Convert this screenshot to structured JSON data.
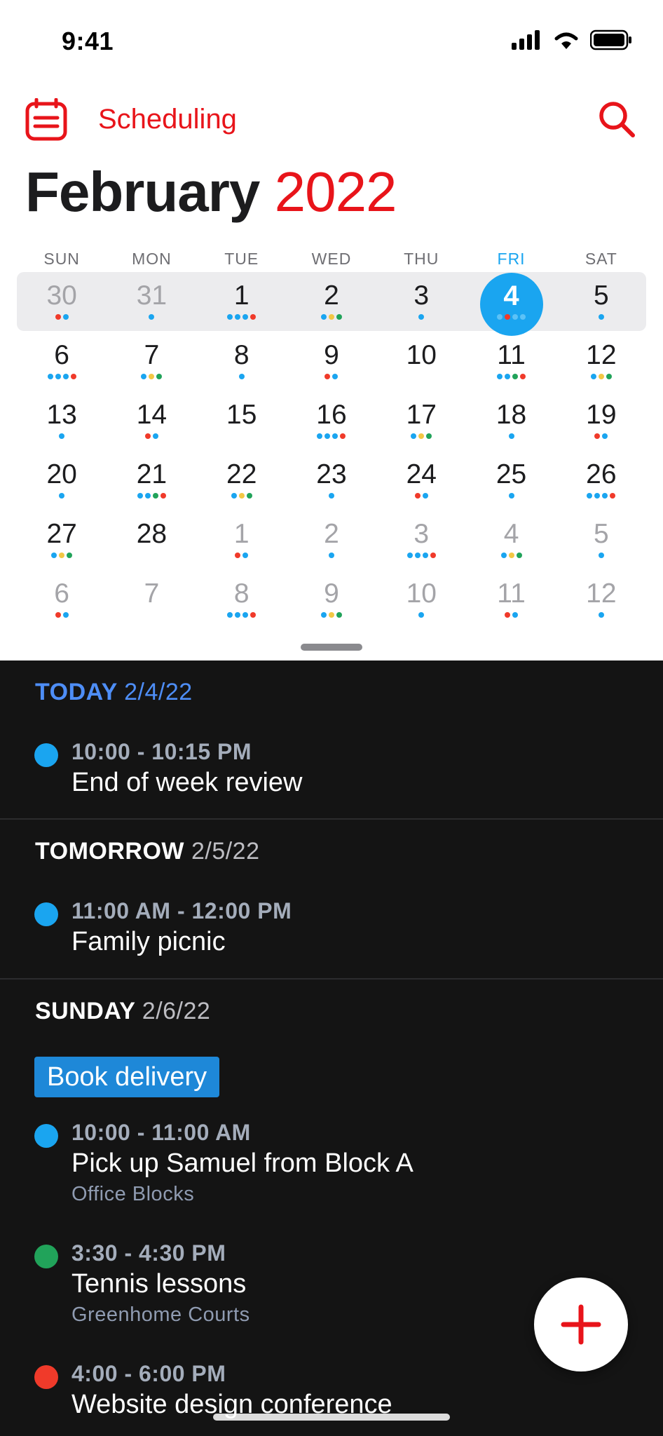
{
  "status": {
    "time": "9:41"
  },
  "header": {
    "app_title": "Scheduling"
  },
  "month": {
    "name": "February",
    "year": "2022"
  },
  "colors": {
    "blue": "#1aa5f0",
    "red": "#f03a2a",
    "green": "#21a35a",
    "yellow": "#f2c744",
    "accent": "#e8141a"
  },
  "weekdays": [
    "SUN",
    "MON",
    "TUE",
    "WED",
    "THU",
    "FRI",
    "SAT"
  ],
  "weeks": [
    [
      {
        "n": "30",
        "m": true,
        "d": [
          "red",
          "blue"
        ]
      },
      {
        "n": "31",
        "m": true,
        "d": [
          "blue"
        ]
      },
      {
        "n": "1",
        "d": [
          "blue",
          "blue",
          "blue",
          "red"
        ]
      },
      {
        "n": "2",
        "d": [
          "blue",
          "yellow",
          "green"
        ]
      },
      {
        "n": "3",
        "d": [
          "blue"
        ]
      },
      {
        "n": "4",
        "t": true,
        "d": [
          "blue",
          "red",
          "blue",
          "blue"
        ]
      },
      {
        "n": "5",
        "d": [
          "blue"
        ]
      }
    ],
    [
      {
        "n": "6",
        "d": [
          "blue",
          "blue",
          "blue",
          "red"
        ]
      },
      {
        "n": "7",
        "d": [
          "blue",
          "yellow",
          "green"
        ]
      },
      {
        "n": "8",
        "d": [
          "blue"
        ]
      },
      {
        "n": "9",
        "d": [
          "red",
          "blue"
        ]
      },
      {
        "n": "10",
        "d": []
      },
      {
        "n": "11",
        "d": [
          "blue",
          "blue",
          "green",
          "red"
        ]
      },
      {
        "n": "12",
        "d": [
          "blue",
          "yellow",
          "green"
        ]
      }
    ],
    [
      {
        "n": "13",
        "d": [
          "blue"
        ]
      },
      {
        "n": "14",
        "d": [
          "red",
          "blue"
        ]
      },
      {
        "n": "15",
        "d": []
      },
      {
        "n": "16",
        "d": [
          "blue",
          "blue",
          "blue",
          "red"
        ]
      },
      {
        "n": "17",
        "d": [
          "blue",
          "yellow",
          "green"
        ]
      },
      {
        "n": "18",
        "d": [
          "blue"
        ]
      },
      {
        "n": "19",
        "d": [
          "red",
          "blue"
        ]
      }
    ],
    [
      {
        "n": "20",
        "d": [
          "blue"
        ]
      },
      {
        "n": "21",
        "d": [
          "blue",
          "blue",
          "green",
          "red"
        ]
      },
      {
        "n": "22",
        "d": [
          "blue",
          "yellow",
          "green"
        ]
      },
      {
        "n": "23",
        "d": [
          "blue"
        ]
      },
      {
        "n": "24",
        "d": [
          "red",
          "blue"
        ]
      },
      {
        "n": "25",
        "d": [
          "blue"
        ]
      },
      {
        "n": "26",
        "d": [
          "blue",
          "blue",
          "blue",
          "red"
        ]
      }
    ],
    [
      {
        "n": "27",
        "d": [
          "blue",
          "yellow",
          "green"
        ]
      },
      {
        "n": "28",
        "d": []
      },
      {
        "n": "1",
        "m": true,
        "d": [
          "red",
          "blue"
        ]
      },
      {
        "n": "2",
        "m": true,
        "d": [
          "blue"
        ]
      },
      {
        "n": "3",
        "m": true,
        "d": [
          "blue",
          "blue",
          "blue",
          "red"
        ]
      },
      {
        "n": "4",
        "m": true,
        "d": [
          "blue",
          "yellow",
          "green"
        ]
      },
      {
        "n": "5",
        "m": true,
        "d": [
          "blue"
        ]
      }
    ],
    [
      {
        "n": "6",
        "m": true,
        "d": [
          "red",
          "blue"
        ]
      },
      {
        "n": "7",
        "m": true,
        "d": []
      },
      {
        "n": "8",
        "m": true,
        "d": [
          "blue",
          "blue",
          "blue",
          "red"
        ]
      },
      {
        "n": "9",
        "m": true,
        "d": [
          "blue",
          "yellow",
          "green"
        ]
      },
      {
        "n": "10",
        "m": true,
        "d": [
          "blue"
        ]
      },
      {
        "n": "11",
        "m": true,
        "d": [
          "red",
          "blue"
        ]
      },
      {
        "n": "12",
        "m": true,
        "d": [
          "blue"
        ]
      }
    ]
  ],
  "agenda": {
    "today": {
      "label": "TODAY",
      "date": "2/4/22",
      "events": [
        {
          "time": "10:00 - 10:15 PM",
          "title": "End of week review",
          "color": "#1aa5f0"
        }
      ]
    },
    "tomorrow": {
      "label": "TOMORROW",
      "date": "2/5/22",
      "events": [
        {
          "time": "11:00 AM - 12:00 PM",
          "title": "Family picnic",
          "color": "#1aa5f0"
        }
      ]
    },
    "sunday": {
      "label": "SUNDAY",
      "date": "2/6/22",
      "all_day": "Book delivery",
      "events": [
        {
          "time": "10:00 - 11:00 AM",
          "title": "Pick up Samuel from Block A",
          "location": "Office Blocks",
          "color": "#1aa5f0"
        },
        {
          "time": "3:30 - 4:30 PM",
          "title": "Tennis lessons",
          "location": "Greenhome Courts",
          "color": "#21a35a"
        },
        {
          "time": "4:00 - 6:00 PM",
          "title": "Website design conference",
          "color": "#f03a2a"
        }
      ]
    }
  }
}
